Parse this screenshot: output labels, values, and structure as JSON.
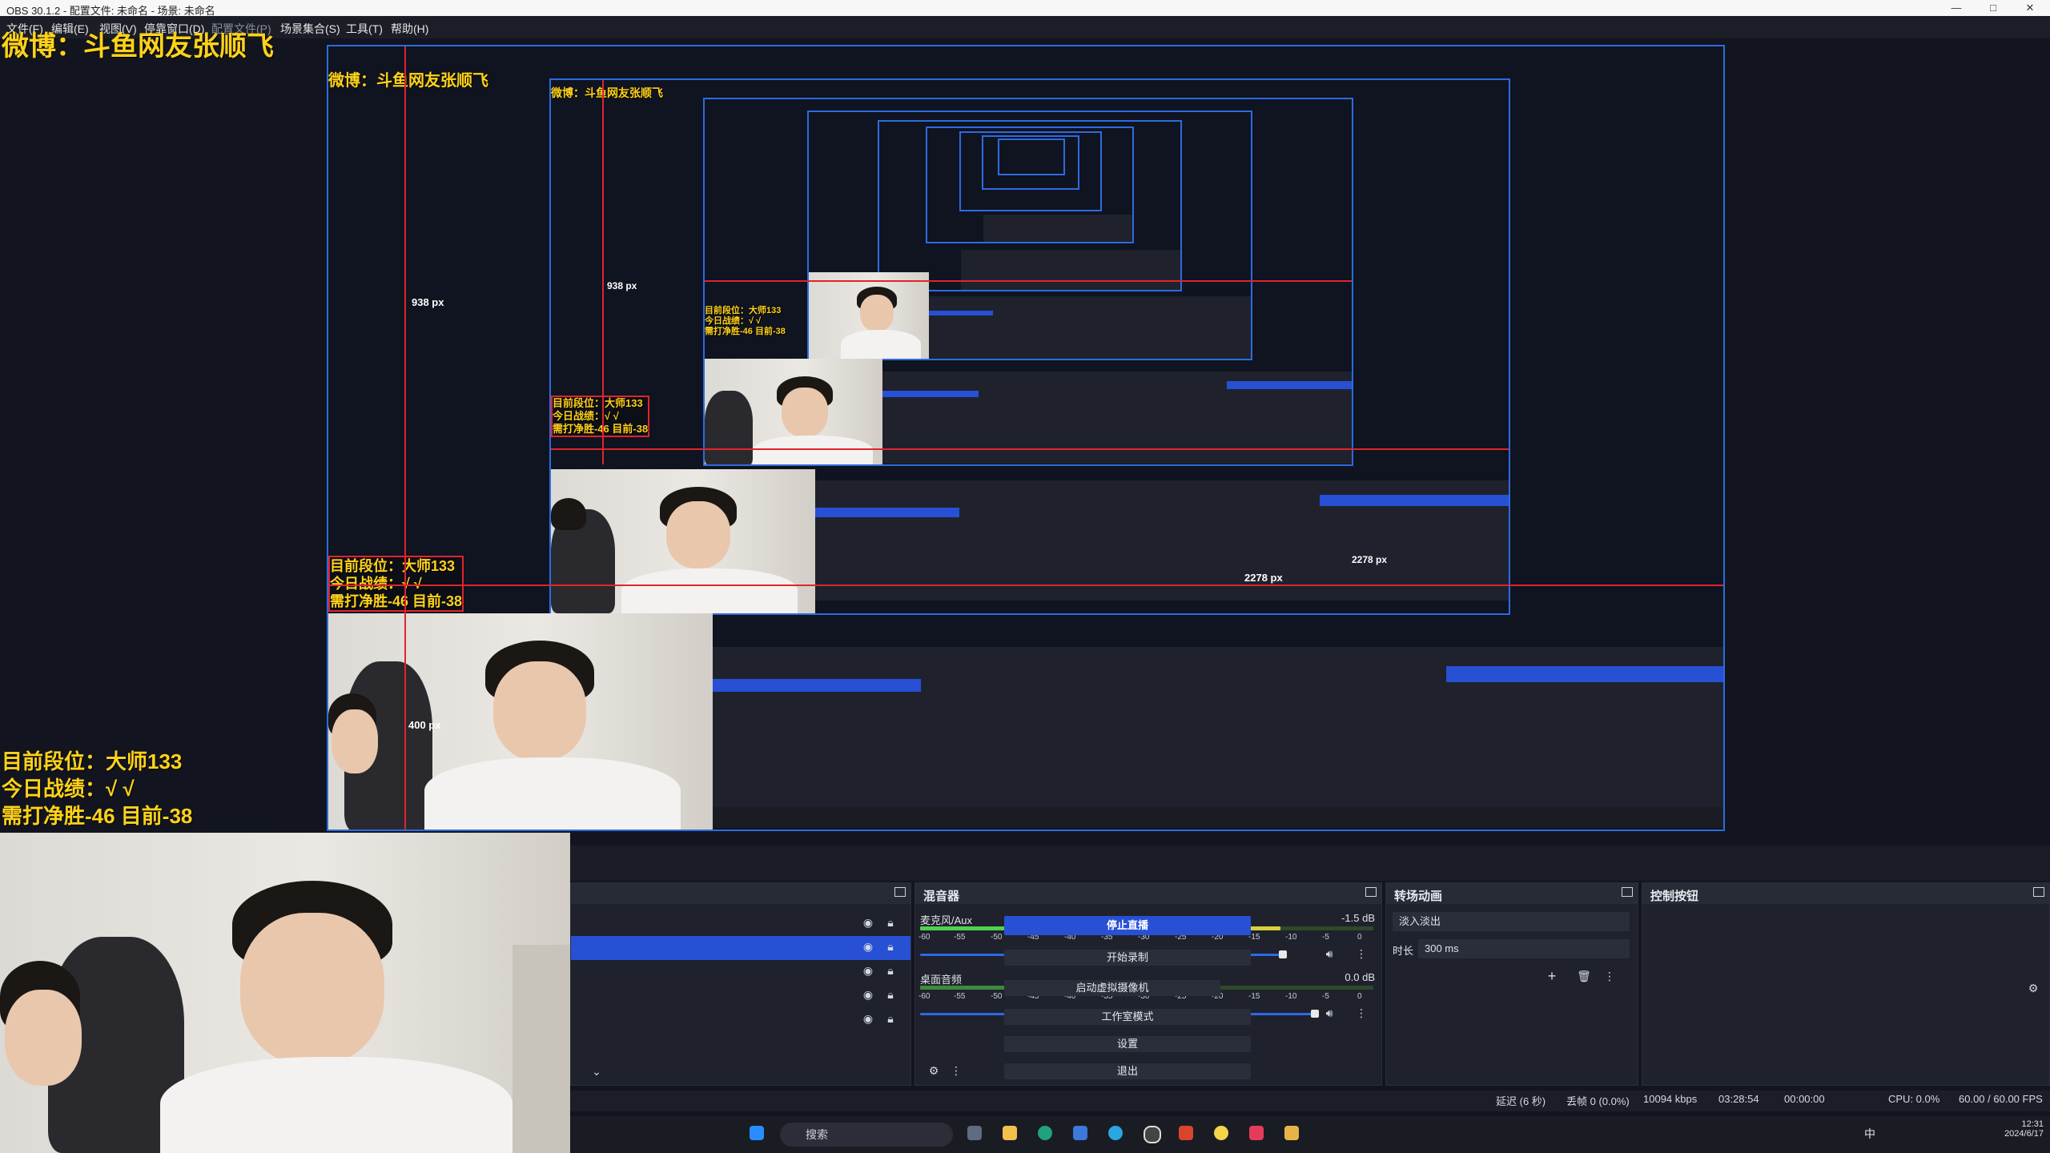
{
  "window": {
    "title": "OBS 30.1.2 - 配置文件: 未命名 - 场景: 未命名",
    "controls": [
      "—",
      "□",
      "✕"
    ]
  },
  "menu": {
    "items": [
      "文件(F)",
      "编辑(E)",
      "视图(V)",
      "停靠窗口(D)",
      "配置文件(P)",
      "场景集合(S)",
      "工具(T)",
      "帮助(H)"
    ]
  },
  "overlay": {
    "weibo": "微博：斗鱼网友张顺飞",
    "rank": "目前段位：大师133",
    "today": "今日战绩：√ √",
    "need": "需打净胜-46 目前-38",
    "measure_v": "938 px",
    "measure_h": "2278 px",
    "measure_small": "400 px"
  },
  "mixer": {
    "title": "混音器",
    "channels": [
      {
        "name": "麦克风/Aux",
        "db": "-1.5 dB",
        "level": 0.78
      },
      {
        "name": "桌面音频",
        "db": "0.0 dB",
        "level": 0.86
      }
    ],
    "scale": [
      "-60",
      "-55",
      "-50",
      "-45",
      "-40",
      "-35",
      "-30",
      "-25",
      "-20",
      "-15",
      "-10",
      "-5",
      "0"
    ]
  },
  "transitions": {
    "title": "转场动画",
    "selected": "淡入淡出",
    "duration_label": "时长",
    "duration_value": "300 ms"
  },
  "controls": {
    "title": "控制按钮",
    "stop_stream": "停止直播",
    "start_record": "开始录制",
    "virtual_cam": "启动虚拟摄像机",
    "studio_mode": "工作室模式",
    "settings": "设置",
    "exit": "退出"
  },
  "status": {
    "delay": "延迟 (6 秒)",
    "dropped": "丢帧 0 (0.0%)",
    "bitrate": "10094 kbps",
    "stream_time": "03:28:54",
    "record_time": "00:00:00",
    "cpu": "CPU: 0.0%",
    "fps": "60.00 / 60.00 FPS"
  },
  "taskbar": {
    "search_placeholder": "搜索",
    "time": "12:31",
    "date": "2024/6/17",
    "ime": "中"
  },
  "colors": {
    "accent": "#2750d4",
    "overlay_text": "#ffd21a",
    "guide_line": "#e0242c",
    "frame_border": "#2c6be0"
  }
}
